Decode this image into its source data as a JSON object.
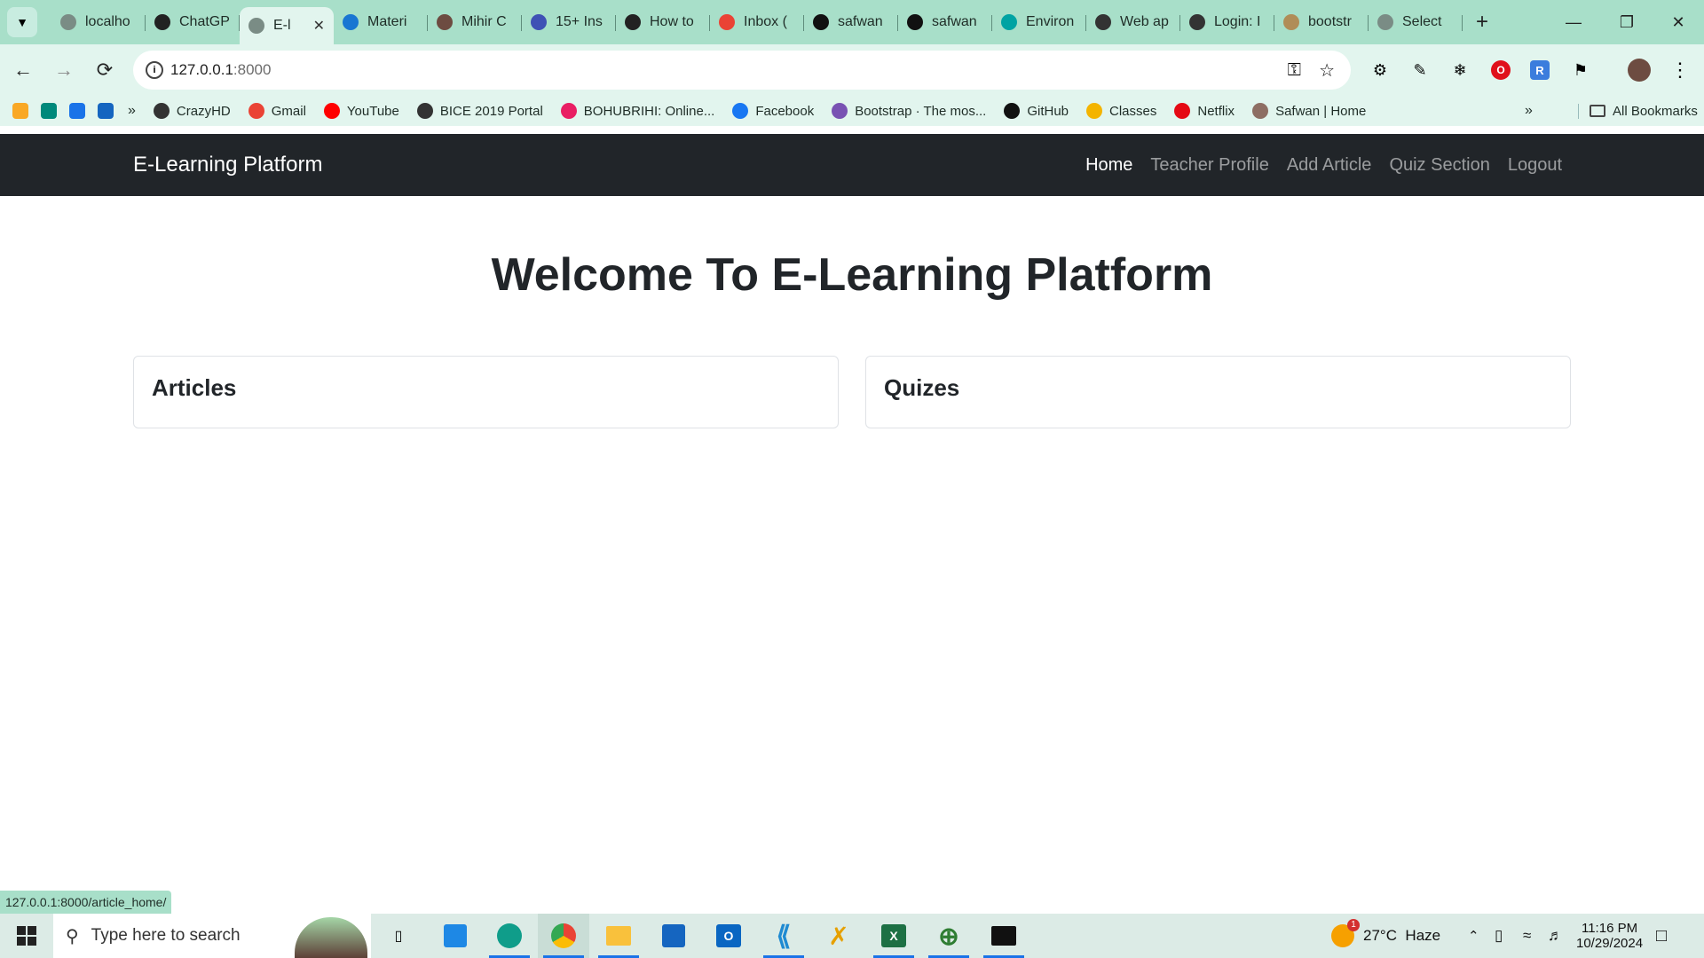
{
  "tabs": [
    {
      "title": "localho",
      "icon": "globe-icon",
      "color": "#7a8c85"
    },
    {
      "title": "ChatGP",
      "icon": "chatgpt-icon",
      "color": "#222222"
    },
    {
      "title": "E-l",
      "icon": "globe-icon",
      "color": "#7a8c85",
      "active": true
    },
    {
      "title": "Materi",
      "icon": "material-icon",
      "color": "#1976d2"
    },
    {
      "title": "Mihir C",
      "icon": "avatar-icon",
      "color": "#6d4c41"
    },
    {
      "title": "15+ Ins",
      "icon": "person-icon",
      "color": "#3f51b5"
    },
    {
      "title": "How to",
      "icon": "video-icon",
      "color": "#222222"
    },
    {
      "title": "Inbox (",
      "icon": "gmail-icon",
      "color": "#ea4335"
    },
    {
      "title": "safwan",
      "icon": "github-icon",
      "color": "#111111"
    },
    {
      "title": "safwan",
      "icon": "github-icon",
      "color": "#111111"
    },
    {
      "title": "Environ",
      "icon": "diamond-icon",
      "color": "#00a3a3"
    },
    {
      "title": "Web ap",
      "icon": "render-icon",
      "color": "#333333"
    },
    {
      "title": "Login: I",
      "icon": "render-icon",
      "color": "#333333"
    },
    {
      "title": "bootstr",
      "icon": "bootstrap-icon",
      "color": "#b08d57"
    },
    {
      "title": "Select",
      "icon": "globe-icon",
      "color": "#7a8c85"
    }
  ],
  "url": {
    "host": "127.0.0.1",
    "port": ":8000"
  },
  "bookmarks": [
    {
      "label": "CrazyHD",
      "icon": "globe-icon",
      "color": "#333333"
    },
    {
      "label": "Gmail",
      "icon": "gmail-icon",
      "color": "#ea4335"
    },
    {
      "label": "YouTube",
      "icon": "youtube-icon",
      "color": "#ff0000"
    },
    {
      "label": "BICE 2019 Portal",
      "icon": "globe-icon",
      "color": "#333333"
    },
    {
      "label": "BOHUBRIHI: Online...",
      "icon": "bohubrihi-icon",
      "color": "#e91e63"
    },
    {
      "label": "Facebook",
      "icon": "facebook-icon",
      "color": "#1877f2"
    },
    {
      "label": "Bootstrap · The mos...",
      "icon": "bootstrap-icon",
      "color": "#7952b3"
    },
    {
      "label": "GitHub",
      "icon": "github-icon",
      "color": "#111111"
    },
    {
      "label": "Classes",
      "icon": "classroom-icon",
      "color": "#f4b400"
    },
    {
      "label": "Netflix",
      "icon": "netflix-icon",
      "color": "#e50914"
    },
    {
      "label": "Safwan | Home",
      "icon": "avatar-icon",
      "color": "#8d6e63"
    }
  ],
  "all_bookmarks": "All Bookmarks",
  "app": {
    "brand": "E-Learning Platform",
    "nav": [
      "Home",
      "Teacher Profile",
      "Add Article",
      "Quiz Section",
      "Logout"
    ],
    "heading": "Welcome To E-Learning Platform",
    "cards": [
      "Articles",
      "Quizes"
    ]
  },
  "status_url": "127.0.0.1:8000/article_home/",
  "taskbar": {
    "search_placeholder": "Type here to search",
    "weather": "27°C  Haze",
    "time": "11:16 PM",
    "date": "10/29/2024",
    "weather_badge": "1"
  }
}
